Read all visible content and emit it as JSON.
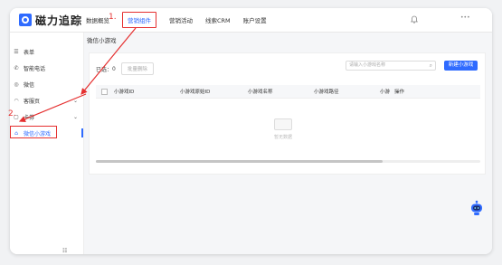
{
  "header": {
    "logo_text": "磁力追踪",
    "nav": [
      "数据概览",
      "营销组件",
      "营销活动",
      "线索CRM",
      "账户设置"
    ],
    "active_nav": "营销组件",
    "user": "•••"
  },
  "annotations": {
    "step1": "1.",
    "step2": "2."
  },
  "sidebar": {
    "items": [
      {
        "icon": "☰",
        "label": "表单"
      },
      {
        "icon": "✆",
        "label": "智能电话"
      },
      {
        "icon": "◎",
        "label": "微信"
      },
      {
        "icon": "◠",
        "label": "客服页"
      },
      {
        "icon": "▢",
        "label": "卡券"
      },
      {
        "icon": "⌂",
        "label": "微信小游戏"
      }
    ],
    "collapse_icon": "☷"
  },
  "main": {
    "title": "微信小游戏",
    "selected_prefix": "已选：",
    "selected_count": "0",
    "batch_delete": "批量删除",
    "search_placeholder": "请输入小游戏名称",
    "new_button": "新建小游戏",
    "columns": [
      "小游戏ID",
      "小游戏原始ID",
      "小游戏名称",
      "小游戏路径",
      "小游",
      "操作"
    ],
    "empty_text": "暂无数据"
  }
}
